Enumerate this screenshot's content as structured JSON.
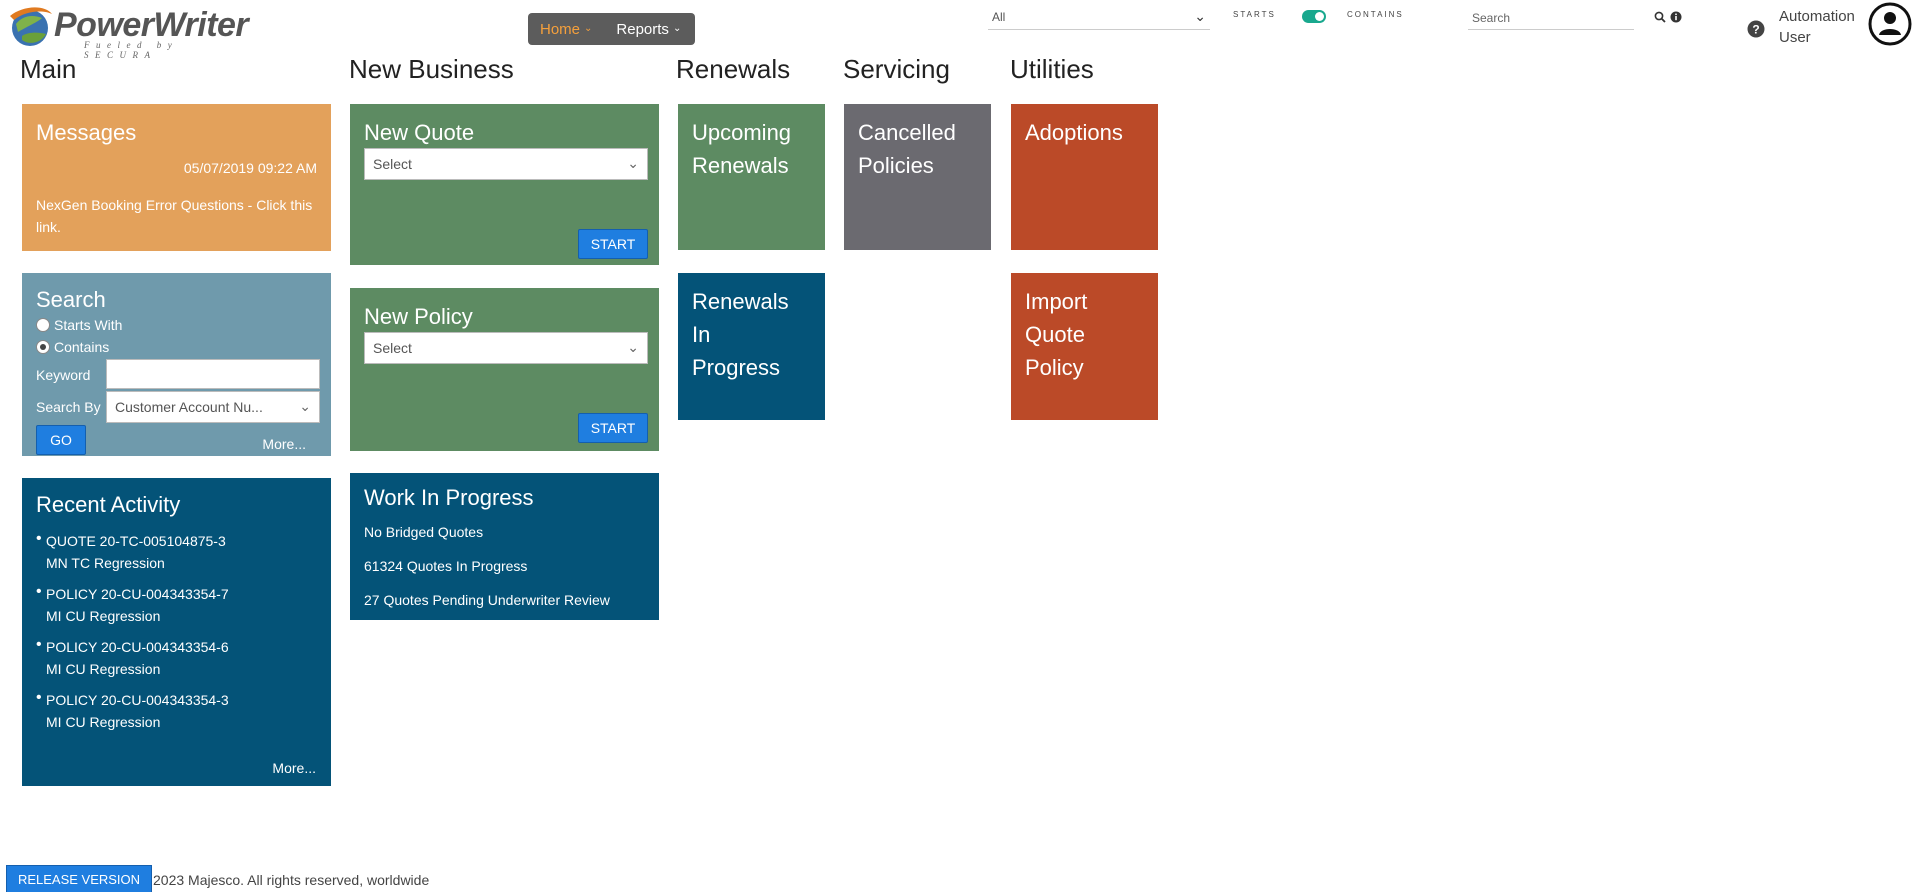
{
  "header": {
    "logo_main": "PowerWriter",
    "logo_tagline": "Fueled by SECURA",
    "nav": [
      {
        "label": "Home"
      },
      {
        "label": "Reports"
      }
    ],
    "filter_value": "All",
    "toggle_left_label": "STARTS",
    "toggle_right_label": "CONTAINS",
    "toggle_state": "contains",
    "search_placeholder": "Search",
    "user_name": "Automation User"
  },
  "sections": {
    "main": "Main",
    "new_business": "New Business",
    "renewals": "Renewals",
    "servicing": "Servicing",
    "utilities": "Utilities"
  },
  "messages": {
    "title": "Messages",
    "date": "05/07/2019 09:22 AM",
    "link_text": "NexGen Booking Error Questions - Click this link."
  },
  "search": {
    "title": "Search",
    "opt_starts": "Starts With",
    "opt_contains": "Contains",
    "selected": "contains",
    "keyword_label": "Keyword",
    "keyword_value": "",
    "search_by_label": "Search By",
    "search_by_value": "Customer Account Nu...",
    "go_label": "GO",
    "more_label": "More..."
  },
  "recent_activity": {
    "title": "Recent Activity",
    "items": [
      {
        "line1": "QUOTE 20-TC-005104875-3",
        "line2": "MN TC Regression"
      },
      {
        "line1": "POLICY 20-CU-004343354-7",
        "line2": "MI CU Regression"
      },
      {
        "line1": "POLICY 20-CU-004343354-6",
        "line2": "MI CU Regression"
      },
      {
        "line1": "POLICY 20-CU-004343354-3",
        "line2": "MI CU Regression"
      }
    ],
    "more_label": "More..."
  },
  "new_quote": {
    "title": "New Quote",
    "select_value": "Select",
    "start_label": "START"
  },
  "new_policy": {
    "title": "New Policy",
    "select_value": "Select",
    "start_label": "START"
  },
  "work_in_progress": {
    "title": "Work In Progress",
    "lines": [
      "No Bridged Quotes",
      "61324 Quotes In Progress",
      "27 Quotes Pending Underwriter Review"
    ]
  },
  "renewals": {
    "upcoming": [
      "Upcoming",
      "Renewals"
    ],
    "in_progress": [
      "Renewals",
      "In",
      "Progress"
    ]
  },
  "servicing": {
    "cancelled": [
      "Cancelled",
      "Policies"
    ]
  },
  "utilities": {
    "adoptions": "Adoptions",
    "import": [
      "Import",
      "Quote",
      "Policy"
    ]
  },
  "footer": {
    "release_label": "RELEASE VERSION",
    "copyright": "2023 Majesco. All rights reserved, worldwide"
  },
  "colors": {
    "orange": "#e3a15b",
    "green": "#5d8b62",
    "teal": "#6f9aac",
    "navy": "#045378",
    "gray": "#6b6a70",
    "rust": "#bb4a28",
    "accent_blue": "#1f7ee0",
    "nav_active": "#f5a03c"
  }
}
